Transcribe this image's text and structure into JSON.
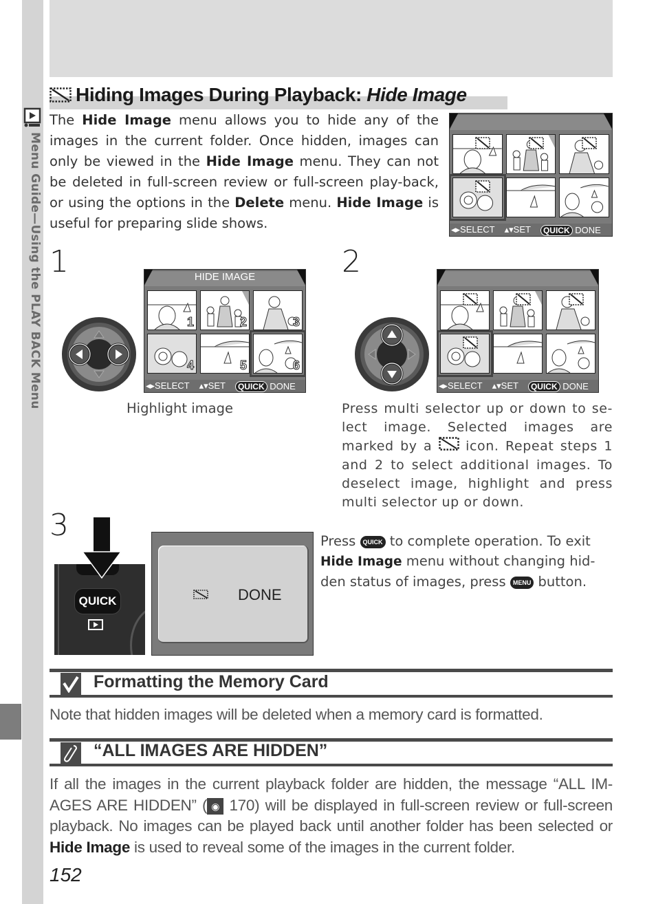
{
  "sidebar": {
    "section_label": "Menu Guide—Using the PLAY BACK Menu",
    "icon": "playback-icon"
  },
  "heading": {
    "icon": "hide-image-icon",
    "title_main": "Hiding Images During Playback: ",
    "title_italic": "Hide Image"
  },
  "intro": {
    "p1": "The ",
    "b1": "Hide Image",
    "p2": " menu allows you to hide any of the images in the current folder. Once hidden, images can only be viewed in the ",
    "b2": "Hide Image",
    "p3": " menu.  They can not be deleted in full-screen review or full-screen play-back, or using the options in the ",
    "b3": "Delete",
    "p4": " menu. ",
    "b4": "Hide Image",
    "p5": " is useful for preparing slide shows."
  },
  "lcd_common": {
    "select": "◂▸SELECT",
    "set": "▴▾SET",
    "quick": "QUICK",
    "done": "DONE"
  },
  "top_lcd": {
    "title": "",
    "thumbs": [
      {
        "hidden": true,
        "selected": false
      },
      {
        "hidden": true,
        "selected": false
      },
      {
        "hidden": true,
        "selected": false
      },
      {
        "hidden": true,
        "selected": true
      },
      {
        "hidden": false,
        "selected": false
      },
      {
        "hidden": false,
        "selected": false
      }
    ]
  },
  "step1": {
    "number": "1",
    "lcd_title": "HIDE IMAGE",
    "thumb_numbers": [
      "1",
      "2",
      "3",
      "4",
      "5",
      "6"
    ],
    "caption": "Highlight image"
  },
  "step2": {
    "number": "2",
    "lcd_title": "",
    "text_a": "Press multi selector up or down to se-lect image. Selected images are marked by a ",
    "text_b": " icon. Repeat steps 1 and 2 to select additional images. To deselect image, highlight and press multi selector up or down."
  },
  "step3": {
    "number": "3",
    "camera_button": "QUICK",
    "screen_text": "DONE",
    "text_a": "Press ",
    "quick_chip": "QUICK",
    "text_b": " to complete operation. To exit ",
    "bold": "Hide Image",
    "text_c": " menu without changing hid-den status of images, press ",
    "menu_chip": "MENU",
    "text_d": " button."
  },
  "note1": {
    "icon": "checkmark-icon",
    "title": "Formatting the Memory Card",
    "text": "Note that hidden images will be deleted when a memory card is formatted."
  },
  "note2": {
    "icon": "pencil-icon",
    "title": "“ALL IMAGES ARE HIDDEN”",
    "text_a": "If all the images in the current playback folder are hidden, the message “ALL IM-AGES ARE HIDDEN” (",
    "ref_page": " 170) will be displayed in full-screen review or full-screen playback. No images can be played back until another folder has been selected or ",
    "bold": "Hide Image",
    "text_b": " is used to reveal some of the images in the current folder."
  },
  "page_number": "152"
}
